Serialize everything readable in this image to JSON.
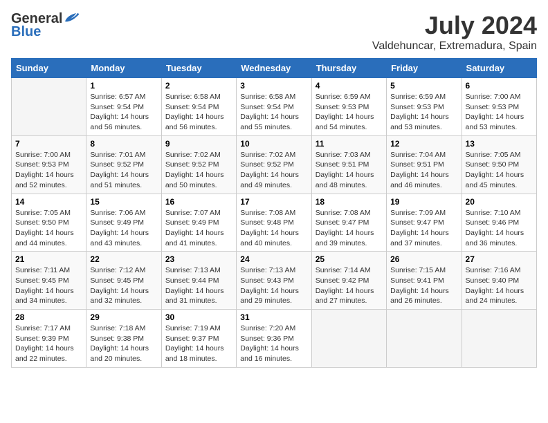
{
  "header": {
    "logo_general": "General",
    "logo_blue": "Blue",
    "month_year": "July 2024",
    "location": "Valdehuncar, Extremadura, Spain"
  },
  "days_of_week": [
    "Sunday",
    "Monday",
    "Tuesday",
    "Wednesday",
    "Thursday",
    "Friday",
    "Saturday"
  ],
  "weeks": [
    [
      {
        "day": "",
        "info": ""
      },
      {
        "day": "1",
        "info": "Sunrise: 6:57 AM\nSunset: 9:54 PM\nDaylight: 14 hours\nand 56 minutes."
      },
      {
        "day": "2",
        "info": "Sunrise: 6:58 AM\nSunset: 9:54 PM\nDaylight: 14 hours\nand 56 minutes."
      },
      {
        "day": "3",
        "info": "Sunrise: 6:58 AM\nSunset: 9:54 PM\nDaylight: 14 hours\nand 55 minutes."
      },
      {
        "day": "4",
        "info": "Sunrise: 6:59 AM\nSunset: 9:53 PM\nDaylight: 14 hours\nand 54 minutes."
      },
      {
        "day": "5",
        "info": "Sunrise: 6:59 AM\nSunset: 9:53 PM\nDaylight: 14 hours\nand 53 minutes."
      },
      {
        "day": "6",
        "info": "Sunrise: 7:00 AM\nSunset: 9:53 PM\nDaylight: 14 hours\nand 53 minutes."
      }
    ],
    [
      {
        "day": "7",
        "info": "Sunrise: 7:00 AM\nSunset: 9:53 PM\nDaylight: 14 hours\nand 52 minutes."
      },
      {
        "day": "8",
        "info": "Sunrise: 7:01 AM\nSunset: 9:52 PM\nDaylight: 14 hours\nand 51 minutes."
      },
      {
        "day": "9",
        "info": "Sunrise: 7:02 AM\nSunset: 9:52 PM\nDaylight: 14 hours\nand 50 minutes."
      },
      {
        "day": "10",
        "info": "Sunrise: 7:02 AM\nSunset: 9:52 PM\nDaylight: 14 hours\nand 49 minutes."
      },
      {
        "day": "11",
        "info": "Sunrise: 7:03 AM\nSunset: 9:51 PM\nDaylight: 14 hours\nand 48 minutes."
      },
      {
        "day": "12",
        "info": "Sunrise: 7:04 AM\nSunset: 9:51 PM\nDaylight: 14 hours\nand 46 minutes."
      },
      {
        "day": "13",
        "info": "Sunrise: 7:05 AM\nSunset: 9:50 PM\nDaylight: 14 hours\nand 45 minutes."
      }
    ],
    [
      {
        "day": "14",
        "info": "Sunrise: 7:05 AM\nSunset: 9:50 PM\nDaylight: 14 hours\nand 44 minutes."
      },
      {
        "day": "15",
        "info": "Sunrise: 7:06 AM\nSunset: 9:49 PM\nDaylight: 14 hours\nand 43 minutes."
      },
      {
        "day": "16",
        "info": "Sunrise: 7:07 AM\nSunset: 9:49 PM\nDaylight: 14 hours\nand 41 minutes."
      },
      {
        "day": "17",
        "info": "Sunrise: 7:08 AM\nSunset: 9:48 PM\nDaylight: 14 hours\nand 40 minutes."
      },
      {
        "day": "18",
        "info": "Sunrise: 7:08 AM\nSunset: 9:47 PM\nDaylight: 14 hours\nand 39 minutes."
      },
      {
        "day": "19",
        "info": "Sunrise: 7:09 AM\nSunset: 9:47 PM\nDaylight: 14 hours\nand 37 minutes."
      },
      {
        "day": "20",
        "info": "Sunrise: 7:10 AM\nSunset: 9:46 PM\nDaylight: 14 hours\nand 36 minutes."
      }
    ],
    [
      {
        "day": "21",
        "info": "Sunrise: 7:11 AM\nSunset: 9:45 PM\nDaylight: 14 hours\nand 34 minutes."
      },
      {
        "day": "22",
        "info": "Sunrise: 7:12 AM\nSunset: 9:45 PM\nDaylight: 14 hours\nand 32 minutes."
      },
      {
        "day": "23",
        "info": "Sunrise: 7:13 AM\nSunset: 9:44 PM\nDaylight: 14 hours\nand 31 minutes."
      },
      {
        "day": "24",
        "info": "Sunrise: 7:13 AM\nSunset: 9:43 PM\nDaylight: 14 hours\nand 29 minutes."
      },
      {
        "day": "25",
        "info": "Sunrise: 7:14 AM\nSunset: 9:42 PM\nDaylight: 14 hours\nand 27 minutes."
      },
      {
        "day": "26",
        "info": "Sunrise: 7:15 AM\nSunset: 9:41 PM\nDaylight: 14 hours\nand 26 minutes."
      },
      {
        "day": "27",
        "info": "Sunrise: 7:16 AM\nSunset: 9:40 PM\nDaylight: 14 hours\nand 24 minutes."
      }
    ],
    [
      {
        "day": "28",
        "info": "Sunrise: 7:17 AM\nSunset: 9:39 PM\nDaylight: 14 hours\nand 22 minutes."
      },
      {
        "day": "29",
        "info": "Sunrise: 7:18 AM\nSunset: 9:38 PM\nDaylight: 14 hours\nand 20 minutes."
      },
      {
        "day": "30",
        "info": "Sunrise: 7:19 AM\nSunset: 9:37 PM\nDaylight: 14 hours\nand 18 minutes."
      },
      {
        "day": "31",
        "info": "Sunrise: 7:20 AM\nSunset: 9:36 PM\nDaylight: 14 hours\nand 16 minutes."
      },
      {
        "day": "",
        "info": ""
      },
      {
        "day": "",
        "info": ""
      },
      {
        "day": "",
        "info": ""
      }
    ]
  ]
}
